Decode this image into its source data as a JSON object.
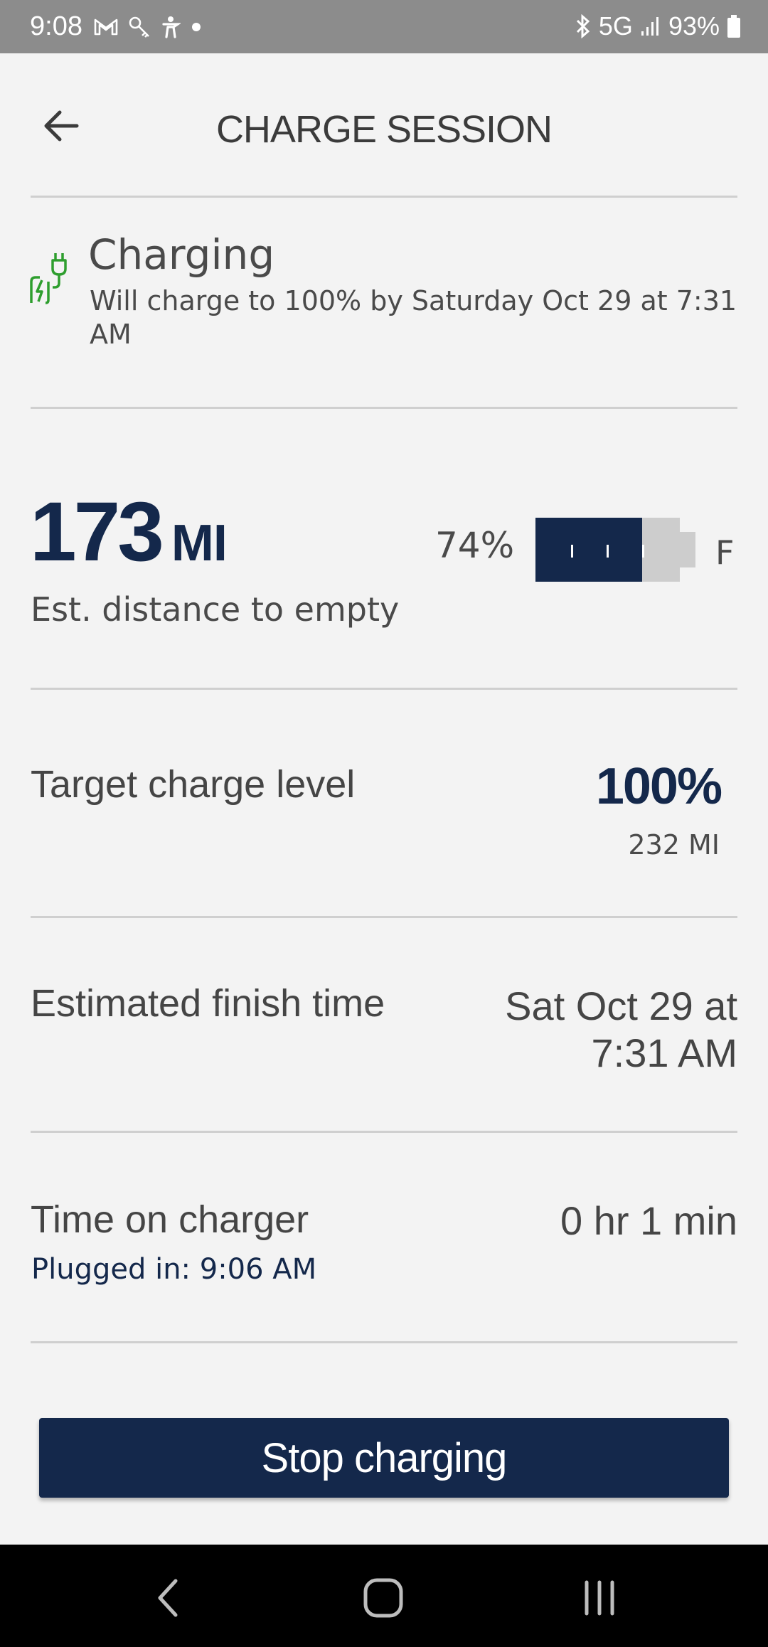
{
  "status_bar": {
    "time": "9:08",
    "left_icons": [
      "gmail-icon",
      "key-icon",
      "accessibility-icon",
      "dot-icon"
    ],
    "network": "5G",
    "battery": "93%"
  },
  "header": {
    "title": "CHARGE SESSION"
  },
  "charging": {
    "title": "Charging",
    "description": "Will charge to 100% by Saturday Oct 29 at 7:31 AM"
  },
  "range": {
    "value": "173",
    "unit": "MI",
    "label": "Est. distance to empty",
    "battery_percent_text": "74%",
    "battery_level": 0.74,
    "full_label": "F"
  },
  "target": {
    "label": "Target charge level",
    "value": "100%",
    "range": "232 MI"
  },
  "finish": {
    "label": "Estimated finish time",
    "line1": "Sat Oct 29 at",
    "line2": "7:31 AM"
  },
  "charger_time": {
    "label": "Time on charger",
    "value": "0 hr 1 min",
    "plugged_in": "Plugged in: 9:06 AM"
  },
  "actions": {
    "stop_label": "Stop charging"
  },
  "colors": {
    "brand_navy": "#14284b",
    "charging_green": "#2e9e2e",
    "background": "#f3f3f3"
  }
}
